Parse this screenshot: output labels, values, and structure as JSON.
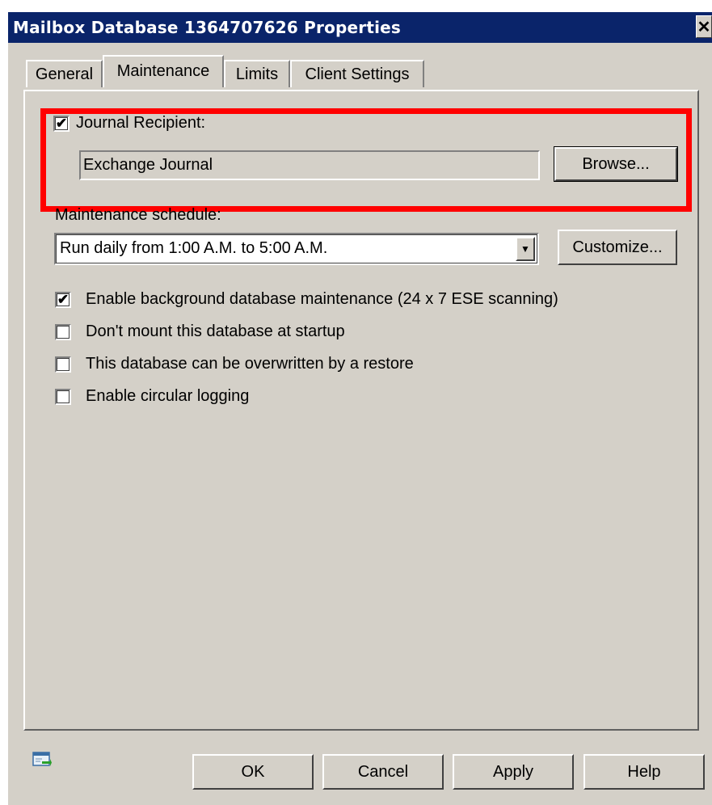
{
  "window": {
    "title": "Mailbox Database 1364707626 Properties",
    "close_glyph": "✕"
  },
  "tabs": [
    {
      "label": "General",
      "active": false
    },
    {
      "label": "Maintenance",
      "active": true
    },
    {
      "label": "Limits",
      "active": false
    },
    {
      "label": "Client Settings",
      "active": false
    }
  ],
  "journal": {
    "checkbox_label": "Journal Recipient:",
    "checked": true,
    "recipient_value": "Exchange Journal",
    "browse_label": "Browse..."
  },
  "schedule": {
    "label": "Maintenance schedule:",
    "selected": "Run daily from 1:00 A.M. to 5:00 A.M.",
    "customize_label": "Customize..."
  },
  "options": [
    {
      "label": "Enable background database maintenance (24 x 7 ESE scanning)",
      "checked": true
    },
    {
      "label": "Don't mount this database at startup",
      "checked": false
    },
    {
      "label": "This database can be overwritten by a restore",
      "checked": false
    },
    {
      "label": "Enable circular logging",
      "checked": false
    }
  ],
  "buttons": {
    "ok": "OK",
    "cancel": "Cancel",
    "apply": "Apply",
    "help": "Help"
  },
  "icons": {
    "help_context": "properties-help-icon"
  },
  "colors": {
    "titlebar": "#0a246a",
    "face": "#d4d0c8",
    "highlight": "#ff0000"
  },
  "check_glyph": "✔"
}
